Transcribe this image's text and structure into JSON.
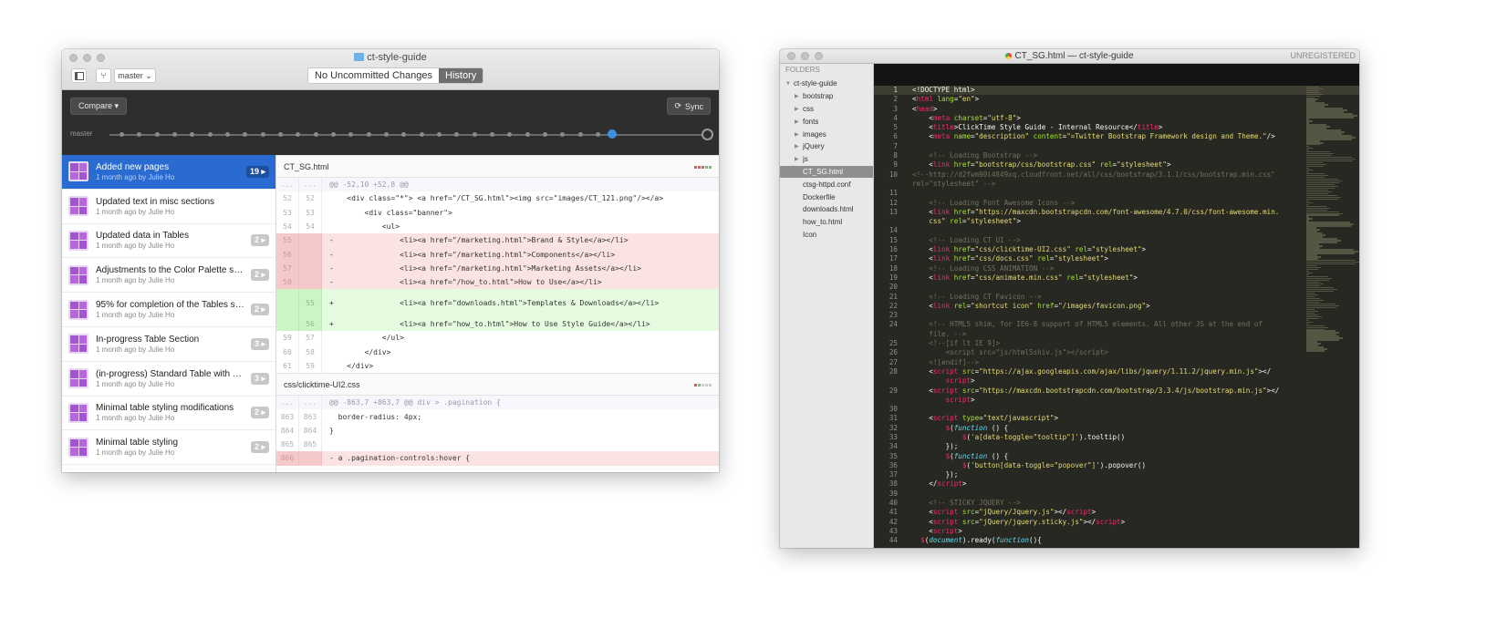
{
  "github": {
    "repo_title": "ct-style-guide",
    "branch": "master",
    "seg_uncommitted": "No Uncommitted Changes",
    "seg_history": "History",
    "compare_label": "Compare ▾",
    "sync_label": "Sync",
    "timeline_label": "master",
    "timeline": {
      "commit_count": 28,
      "head_fraction": 0.84
    },
    "commits": [
      {
        "title": "Added new pages",
        "meta": "1 month ago by Julie Ho",
        "badge": "19 ▸",
        "active": true
      },
      {
        "title": "Updated text in misc sections",
        "meta": "1 month ago by Julie Ho",
        "badge": ""
      },
      {
        "title": "Updated data in Tables",
        "meta": "1 month ago by Julie Ho",
        "badge": "2 ▸"
      },
      {
        "title": "Adjustments to the Color Palette sect…",
        "meta": "1 month ago by Julie Ho",
        "badge": "2 ▸"
      },
      {
        "title": "95% for completion of the Tables sec…",
        "meta": "1 month ago by Julie Ho",
        "badge": "2 ▸"
      },
      {
        "title": "In-progress Table Section",
        "meta": "1 month ago by Julie Ho",
        "badge": "3 ▸"
      },
      {
        "title": "(in-progress) Standard Table with bor…",
        "meta": "1 month ago by Julie Ho",
        "badge": "3 ▸"
      },
      {
        "title": "Minimal table styling modifications",
        "meta": "1 month ago by Julie Ho",
        "badge": "2 ▸"
      },
      {
        "title": "Minimal table styling",
        "meta": "1 month ago by Julie Ho",
        "badge": "2 ▸"
      }
    ],
    "files": [
      {
        "name": "CT_SG.html",
        "stat_colors": [
          "#e05a5a",
          "#e05a5a",
          "#e05a5a",
          "#6cc46c",
          "#6cc46c"
        ],
        "lines": [
          {
            "type": "hunk",
            "old": "...",
            "new": "...",
            "code": "@@ -52,10 +52,8 @@"
          },
          {
            "type": "ctx",
            "old": "52",
            "new": "52",
            "code": "    <div class=\"*\"> <a href=\"/CT_SG.html\"><img src=\"images/CT_121.png\"/></a>"
          },
          {
            "type": "ctx",
            "old": "53",
            "new": "53",
            "code": "        <div class=\"banner\">"
          },
          {
            "type": "ctx",
            "old": "54",
            "new": "54",
            "code": "            <ul>"
          },
          {
            "type": "del",
            "old": "55",
            "new": "",
            "code": "-               <li><a href=\"/marketing.html\">Brand & Style</a></li>"
          },
          {
            "type": "del",
            "old": "56",
            "new": "",
            "code": "-               <li><a href=\"/marketing.html\">Components</a></li>"
          },
          {
            "type": "del",
            "old": "57",
            "new": "",
            "code": "-               <li><a href=\"/marketing.html\">Marketing Assets</a></li>"
          },
          {
            "type": "del",
            "old": "58",
            "new": "",
            "code": "-               <li><a href=\"/how_to.html\">How to Use</a></li>"
          },
          {
            "type": "add tall",
            "old": "",
            "new": "55",
            "code": "+               <li><a href=\"downloads.html\">Templates & Downloads</a></li>"
          },
          {
            "type": "add",
            "old": "",
            "new": "56",
            "code": "+               <li><a href=\"how_to.html\">How to Use Style Guide</a></li>"
          },
          {
            "type": "ctx",
            "old": "59",
            "new": "57",
            "code": "            </ul>"
          },
          {
            "type": "ctx",
            "old": "60",
            "new": "58",
            "code": "        </div>"
          },
          {
            "type": "ctx",
            "old": "61",
            "new": "59",
            "code": "    </div>"
          }
        ]
      },
      {
        "name": "css/clicktime-UI2.css",
        "stat_colors": [
          "#e05a5a",
          "#6cc46c",
          "#cccccc",
          "#cccccc",
          "#cccccc"
        ],
        "lines": [
          {
            "type": "hunk",
            "old": "...",
            "new": "...",
            "code": "@@ -863,7 +863,7 @@ div > .pagination {"
          },
          {
            "type": "ctx",
            "old": "863",
            "new": "863",
            "code": "  border-radius: 4px;"
          },
          {
            "type": "ctx",
            "old": "864",
            "new": "864",
            "code": "}"
          },
          {
            "type": "ctx",
            "old": "865",
            "new": "865",
            "code": ""
          },
          {
            "type": "del",
            "old": "866",
            "new": "",
            "code": "- a .pagination-controls:hover {"
          }
        ]
      }
    ]
  },
  "sublime": {
    "title": "CT_SG.html — ct-style-guide",
    "unregistered": "UNREGISTERED",
    "sidebar_header": "FOLDERS",
    "tree": [
      {
        "label": "ct-style-guide",
        "depth": 0,
        "arrow": "▼"
      },
      {
        "label": "bootstrap",
        "depth": 1,
        "arrow": "▶"
      },
      {
        "label": "css",
        "depth": 1,
        "arrow": "▶"
      },
      {
        "label": "fonts",
        "depth": 1,
        "arrow": "▶"
      },
      {
        "label": "images",
        "depth": 1,
        "arrow": "▶"
      },
      {
        "label": "jQuery",
        "depth": 1,
        "arrow": "▶"
      },
      {
        "label": "js",
        "depth": 1,
        "arrow": "▶"
      },
      {
        "label": "CT_SG.html",
        "depth": 1,
        "arrow": "",
        "selected": true
      },
      {
        "label": "ctsg-httpd.conf",
        "depth": 1,
        "arrow": ""
      },
      {
        "label": "Dockerfile",
        "depth": 1,
        "arrow": ""
      },
      {
        "label": "downloads.html",
        "depth": 1,
        "arrow": ""
      },
      {
        "label": "how_to.html",
        "depth": 1,
        "arrow": ""
      },
      {
        "label": "Icon",
        "depth": 1,
        "arrow": ""
      }
    ],
    "code_lines": [
      {
        "n": "1",
        "html": "&lt;!DOCTYPE html&gt;",
        "current": true
      },
      {
        "n": "2",
        "html": "&lt;<span class='tg'>html</span> <span class='at'>lang</span>=<span class='st'>\"en\"</span>&gt;"
      },
      {
        "n": "3",
        "html": "&lt;<span class='tg'>head</span>&gt;"
      },
      {
        "n": "4",
        "html": "    &lt;<span class='tg'>meta</span> <span class='at'>charset</span>=<span class='st'>\"utf-8\"</span>&gt;"
      },
      {
        "n": "5",
        "html": "    &lt;<span class='tg'>title</span>&gt;ClickTime Style Guide - Internal Resource&lt;/<span class='tg'>title</span>&gt;"
      },
      {
        "n": "6",
        "html": "    &lt;<span class='tg'>meta</span> <span class='at'>name</span>=<span class='st'>\"description\"</span> <span class='at'>content</span>=<span class='st'>\"=Twitter Bootstrap Framework design and Theme.\"</span>/&gt;"
      },
      {
        "n": "7",
        "html": ""
      },
      {
        "n": "8",
        "html": "    <span class='cm'>&lt;!-- Loading Bootstrap --&gt;</span>"
      },
      {
        "n": "9",
        "html": "    &lt;<span class='tg'>link</span> <span class='at'>href</span>=<span class='st'>\"bootstrap/css/bootstrap.css\"</span> <span class='at'>rel</span>=<span class='st'>\"stylesheet\"</span>&gt;"
      },
      {
        "n": "10",
        "html": "<span class='cm'>&lt;!--http://d2fwm90i4849xq.cloudfront.net/all/css/bootstrap/3.1.1/css/bootstrap.min.css\"</span>"
      },
      {
        "n": "",
        "html": "<span class='cm'>rel=\"stylesheet\" --&gt;</span>"
      },
      {
        "n": "11",
        "html": ""
      },
      {
        "n": "12",
        "html": "    <span class='cm'>&lt;!-- Loading Font Awesome Icons --&gt;</span>"
      },
      {
        "n": "13",
        "html": "    &lt;<span class='tg'>link</span> <span class='at'>href</span>=<span class='st'>\"https://maxcdn.bootstrapcdn.com/font-awesome/4.7.0/css/font-awesome.min.</span>"
      },
      {
        "n": "",
        "html": "    <span class='st'>css\"</span> <span class='at'>rel</span>=<span class='st'>\"stylesheet\"</span>&gt;"
      },
      {
        "n": "14",
        "html": ""
      },
      {
        "n": "15",
        "html": "    <span class='cm'>&lt;!-- Loading CT UI --&gt;</span>"
      },
      {
        "n": "16",
        "html": "    &lt;<span class='tg'>link</span> <span class='at'>href</span>=<span class='st'>\"css/clicktime-UI2.css\"</span> <span class='at'>rel</span>=<span class='st'>\"stylesheet\"</span>&gt;"
      },
      {
        "n": "17",
        "html": "    &lt;<span class='tg'>link</span> <span class='at'>href</span>=<span class='st'>\"css/docs.css\"</span> <span class='at'>rel</span>=<span class='st'>\"stylesheet\"</span>&gt;"
      },
      {
        "n": "18",
        "html": "    <span class='cm'>&lt;!-- Loading CSS ANIMATION --&gt;</span>"
      },
      {
        "n": "19",
        "html": "    &lt;<span class='tg'>link</span> <span class='at'>href</span>=<span class='st'>\"css/animate.min.css\"</span> <span class='at'>rel</span>=<span class='st'>\"stylesheet\"</span>&gt;"
      },
      {
        "n": "20",
        "html": ""
      },
      {
        "n": "21",
        "html": "    <span class='cm'>&lt;!-- Loading CT Favicon --&gt;</span>"
      },
      {
        "n": "22",
        "html": "    &lt;<span class='tg'>link</span> <span class='at'>rel</span>=<span class='st'>\"shortcut icon\"</span> <span class='at'>href</span>=<span class='st'>\"/images/favicon.png\"</span>&gt;"
      },
      {
        "n": "23",
        "html": ""
      },
      {
        "n": "24",
        "html": "    <span class='cm'>&lt;!-- HTML5 shim, for IE6-8 support of HTML5 elements. All other JS at the end of</span>"
      },
      {
        "n": "",
        "html": "    <span class='cm'>file. --&gt;</span>"
      },
      {
        "n": "25",
        "html": "    <span class='cm'>&lt;!--[if lt IE 9]&gt;</span>"
      },
      {
        "n": "26",
        "html": "        <span class='cm'>&lt;script src=\"js/html5shiv.js\"&gt;&lt;/script&gt;</span>"
      },
      {
        "n": "27",
        "html": "    <span class='cm'>&lt;![endif]--&gt;</span>"
      },
      {
        "n": "28",
        "html": "    &lt;<span class='tg'>script</span> <span class='at'>src</span>=<span class='st'>\"https://ajax.googleapis.com/ajax/libs/jquery/1.11.2/jquery.min.js\"</span>&gt;&lt;/"
      },
      {
        "n": "",
        "html": "        <span class='tg'>script</span>&gt;"
      },
      {
        "n": "29",
        "html": "    &lt;<span class='tg'>script</span> <span class='at'>src</span>=<span class='st'>\"https://maxcdn.bootstrapcdn.com/bootstrap/3.3.4/js/bootstrap.min.js\"</span>&gt;&lt;/"
      },
      {
        "n": "",
        "html": "        <span class='tg'>script</span>&gt;"
      },
      {
        "n": "30",
        "html": ""
      },
      {
        "n": "31",
        "html": "    &lt;<span class='tg'>script</span> <span class='at'>type</span>=<span class='st'>\"text/javascript\"</span>&gt;"
      },
      {
        "n": "32",
        "html": "        <span class='tg'>$</span>(<span class='kw'>function</span> () {"
      },
      {
        "n": "33",
        "html": "            <span class='tg'>$</span>(<span class='st'>'a[data-toggle=\"tooltip\"]'</span>).tooltip()"
      },
      {
        "n": "34",
        "html": "        });"
      },
      {
        "n": "35",
        "html": "        <span class='tg'>$</span>(<span class='kw'>function</span> () {"
      },
      {
        "n": "36",
        "html": "            <span class='tg'>$</span>(<span class='st'>'button[data-toggle=\"popover\"]'</span>).popover()"
      },
      {
        "n": "37",
        "html": "        });"
      },
      {
        "n": "38",
        "html": "    &lt;/<span class='tg'>script</span>&gt;"
      },
      {
        "n": "39",
        "html": ""
      },
      {
        "n": "40",
        "html": "    <span class='cm'>&lt;!-- STICKY JQUERY --&gt;</span>"
      },
      {
        "n": "41",
        "html": "    &lt;<span class='tg'>script</span> <span class='at'>src</span>=<span class='st'>\"jQuery/Jquery.js\"</span>&gt;&lt;/<span class='tg'>script</span>&gt;"
      },
      {
        "n": "42",
        "html": "    &lt;<span class='tg'>script</span> <span class='at'>src</span>=<span class='st'>\"jQuery/jquery.sticky.js\"</span>&gt;&lt;/<span class='tg'>script</span>&gt;"
      },
      {
        "n": "43",
        "html": "    &lt;<span class='tg'>script</span>&gt;"
      },
      {
        "n": "44",
        "html": "  <span class='tg'>$</span>(<span class='kw'>document</span>).ready(<span class='kw'>function</span>(){"
      }
    ]
  }
}
